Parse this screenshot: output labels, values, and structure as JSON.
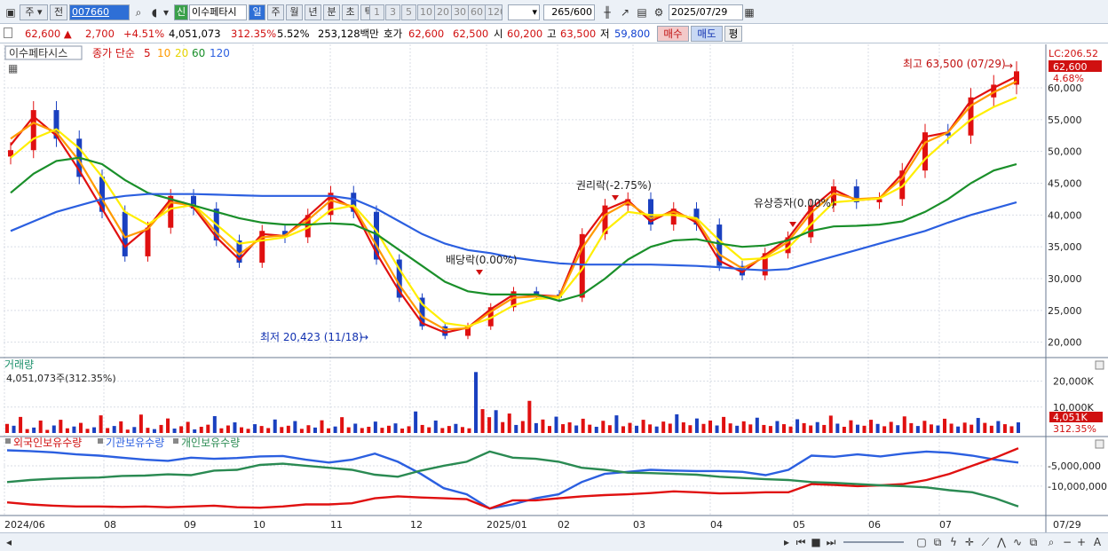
{
  "toolbar": {
    "market": "주",
    "type": "전",
    "code": "007660",
    "badge": "신",
    "name": "이수페타시",
    "periods": [
      "일",
      "주",
      "월",
      "년",
      "분",
      "초",
      "틱"
    ],
    "active_period": "일",
    "minute_steps": [
      "1",
      "3",
      "5",
      "10",
      "20",
      "30",
      "60",
      "120"
    ],
    "count": "265",
    "count_total": "/600",
    "date": "2025/07/29"
  },
  "quote": {
    "price": "62,600",
    "change": "2,700",
    "change_pct": "+4.51%",
    "volume": "4,051,073",
    "volume_ratio": "312.35%",
    "turnover": "5.52%",
    "amount": "253,128백만",
    "hoga_label": "호가",
    "ask": "62,600",
    "bid": "62,500",
    "open_label": "시",
    "open": "60,200",
    "high_label": "고",
    "high": "63,500",
    "low_label": "저",
    "low": "59,800",
    "buy": "매수",
    "sell": "매도",
    "eval": "평"
  },
  "price_panel": {
    "stock": "이수페타시스",
    "legend_prefix": "종가 단순",
    "ma_periods": [
      "5",
      "10",
      "20",
      "60",
      "120"
    ],
    "lc": "LC:206.52",
    "last": "62,600",
    "last_pct": "4.68%",
    "high_note": "최고 63,500 (07/29)",
    "low_note": "최저 20,423 (11/18)",
    "events": [
      "배당락(0.00%)",
      "권리락(-2.75%)",
      "유상증자(0.00%)"
    ]
  },
  "volume_panel": {
    "title": "거래량",
    "value": "4,051,073주(312.35%)",
    "last": "4,051K",
    "last_pct": "312.35%"
  },
  "holding_panel": {
    "series": [
      "외국인보유수량",
      "기관보유수량",
      "개인보유수량"
    ]
  },
  "chart_data": [
    {
      "type": "line",
      "title": "이수페타시스 일봉",
      "x": [
        "2024/06",
        "08",
        "09",
        "10",
        "11",
        "12",
        "2025/01",
        "02",
        "03",
        "04",
        "05",
        "06",
        "07",
        "07/29"
      ],
      "ylim": [
        18000,
        66000
      ],
      "yticks": [
        "20,000",
        "25,000",
        "30,000",
        "35,000",
        "40,000",
        "45,000",
        "50,000",
        "55,000",
        "60,000"
      ],
      "series": [
        {
          "name": "종가",
          "color": "#e01010",
          "values": [
            50200,
            56500,
            52000,
            46000,
            40500,
            33500,
            38000,
            43000,
            41000,
            36000,
            32500,
            37500,
            36500,
            40000,
            43500,
            40500,
            33000,
            27000,
            22500,
            21000,
            22500,
            25500,
            28000,
            27500,
            27000,
            37000,
            41500,
            42500,
            38500,
            41000,
            38500,
            32000,
            30500,
            34000,
            36500,
            41500,
            44500,
            42000,
            42500,
            47000,
            53000,
            52500,
            58500,
            60500,
            62600
          ]
        },
        {
          "name": "5",
          "color": "#e01010",
          "values": [
            51000,
            55500,
            52500,
            47000,
            41000,
            35000,
            38000,
            42500,
            41200,
            36500,
            33000,
            37000,
            36700,
            39800,
            43000,
            41000,
            34000,
            28000,
            23000,
            21500,
            22300,
            25200,
            27500,
            27400,
            27200,
            36000,
            40800,
            42300,
            39000,
            40800,
            38800,
            32800,
            31000,
            33700,
            36300,
            41000,
            44000,
            42300,
            42600,
            46500,
            52300,
            53000,
            58000,
            60000,
            61800
          ]
        },
        {
          "name": "10",
          "color": "#ff9a00",
          "values": [
            52000,
            54500,
            53000,
            48500,
            42500,
            36500,
            37800,
            42000,
            41500,
            37200,
            33800,
            36500,
            36800,
            39200,
            42300,
            41300,
            35200,
            29000,
            24000,
            22000,
            22200,
            24800,
            27000,
            27200,
            27200,
            34800,
            40000,
            42000,
            39500,
            40500,
            39200,
            33800,
            31600,
            33400,
            35800,
            40300,
            43400,
            42500,
            42700,
            45800,
            51400,
            53000,
            57200,
            59300,
            61000
          ]
        },
        {
          "name": "20",
          "color": "#ffee00",
          "values": [
            49000,
            52000,
            53500,
            50500,
            46000,
            40500,
            38500,
            41000,
            41600,
            38500,
            35500,
            36000,
            36500,
            38000,
            40800,
            41500,
            37500,
            31500,
            26000,
            23000,
            22500,
            23800,
            25800,
            26800,
            27000,
            31500,
            37500,
            40500,
            40000,
            40000,
            39500,
            36000,
            33000,
            33200,
            34800,
            38500,
            42000,
            42300,
            42600,
            44500,
            48800,
            52000,
            55000,
            57000,
            58500
          ]
        },
        {
          "name": "60",
          "color": "#1a8f2a",
          "values": [
            43500,
            46500,
            48500,
            49000,
            48000,
            45500,
            43500,
            42500,
            41500,
            40500,
            39500,
            38800,
            38500,
            38500,
            38700,
            38500,
            37000,
            34500,
            32000,
            29500,
            28000,
            27500,
            27500,
            27500,
            26500,
            27500,
            30000,
            33000,
            35000,
            36000,
            36200,
            35500,
            35000,
            35200,
            36000,
            37500,
            38200,
            38300,
            38500,
            39000,
            40500,
            42500,
            45000,
            47000,
            48000
          ]
        },
        {
          "name": "120",
          "color": "#2b5fe0",
          "values": [
            37500,
            39000,
            40500,
            41500,
            42500,
            43000,
            43300,
            43300,
            43300,
            43200,
            43100,
            43000,
            43000,
            43000,
            43000,
            42500,
            41000,
            39000,
            37000,
            35500,
            34500,
            34000,
            33300,
            32800,
            32400,
            32200,
            32200,
            32200,
            32200,
            32100,
            32000,
            31800,
            31500,
            31300,
            31500,
            32500,
            33500,
            34500,
            35500,
            36500,
            37500,
            38800,
            40000,
            41000,
            42000
          ]
        }
      ]
    },
    {
      "type": "bar",
      "title": "거래량",
      "ylim": [
        0,
        26000000
      ],
      "yticks": [
        "10,000K",
        "20,000K"
      ],
      "values": [
        3.5,
        2.8,
        6.2,
        1.5,
        2.1,
        4.8,
        1.2,
        2.9,
        5.1,
        1.8,
        2.5,
        3.9,
        1.6,
        2.2,
        6.8,
        1.9,
        2.7,
        4.5,
        1.3,
        2.3,
        7.1,
        2.0,
        1.5,
        3.1,
        5.6,
        1.7,
        2.6,
        4.3,
        1.4,
        2.4,
        3.2,
        6.5,
        1.8,
        2.9,
        4.1,
        2.2,
        1.6,
        3.4,
        2.7,
        1.9,
        5.2,
        2.3,
        2.8,
        4.6,
        1.6,
        3.0,
        2.1,
        4.9,
        1.8,
        2.5,
        6.1,
        2.2,
        3.6,
        1.9,
        2.4,
        4.4,
        2.0,
        2.8,
        3.7,
        1.7,
        2.6,
        8.3,
        3.1,
        2.2,
        4.8,
        1.9,
        2.7,
        3.5,
        2.3,
        1.8,
        23.5,
        9.2,
        6.1,
        8.8,
        4.2,
        7.5,
        3.1,
        4.6,
        12.4,
        3.8,
        5.2,
        2.7,
        6.3,
        3.4,
        4.1,
        2.9,
        5.5,
        3.2,
        2.4,
        4.7,
        3.0,
        6.8,
        2.6,
        3.9,
        2.8,
        5.1,
        3.3,
        2.5,
        4.4,
        3.6,
        7.2,
        4.1,
        3.0,
        5.6,
        3.5,
        4.8,
        2.9,
        6.2,
        3.7,
        2.8,
        4.5,
        3.3,
        5.9,
        3.1,
        2.7,
        4.6,
        3.4,
        2.5,
        5.3,
        3.8,
        2.9,
        4.2,
        3.1,
        6.7,
        3.6,
        2.4,
        4.9,
        3.2,
        2.8,
        5.1,
        3.5,
        2.6,
        4.3,
        3.0,
        6.4,
        3.8,
        2.7,
        4.7,
        3.3,
        2.9,
        5.5,
        3.6,
        2.5,
        4.0,
        3.2,
        5.8,
        3.9,
        2.8,
        4.6,
        3.4,
        2.6,
        4.1
      ]
    },
    {
      "type": "line",
      "title": "보유수량",
      "ylim": [
        -17000000,
        0
      ],
      "yticks": [
        "-5,000,000",
        "-10,000,000"
      ],
      "series": [
        {
          "name": "외국인보유수량",
          "color": "#2b5fe0",
          "values": [
            -1200000,
            -1400000,
            -1700000,
            -2200000,
            -2500000,
            -3000000,
            -3500000,
            -3800000,
            -3000000,
            -3300000,
            -3100000,
            -2700000,
            -2600000,
            -3500000,
            -4200000,
            -3500000,
            -2000000,
            -4000000,
            -7000000,
            -10500000,
            -12000000,
            -15500000,
            -14500000,
            -13000000,
            -12000000,
            -9000000,
            -7000000,
            -6500000,
            -6000000,
            -6200000,
            -6300000,
            -6300000,
            -6500000,
            -7300000,
            -6000000,
            -2500000,
            -2800000,
            -2200000,
            -2700000,
            -2000000,
            -1500000,
            -1800000,
            -2500000,
            -3500000,
            -4200000
          ]
        },
        {
          "name": "기관보유수량",
          "color": "#e01010",
          "values": [
            -14000000,
            -14500000,
            -14800000,
            -15000000,
            -15000000,
            -15100000,
            -15000000,
            -15200000,
            -15000000,
            -14800000,
            -15200000,
            -15300000,
            -15000000,
            -14500000,
            -14500000,
            -14200000,
            -13000000,
            -12500000,
            -12800000,
            -13000000,
            -13200000,
            -15500000,
            -13500000,
            -13500000,
            -13000000,
            -12500000,
            -12200000,
            -12000000,
            -11700000,
            -11300000,
            -11500000,
            -11800000,
            -11700000,
            -11500000,
            -11500000,
            -9500000,
            -9700000,
            -10000000,
            -9800000,
            -9500000,
            -8500000,
            -7000000,
            -5000000,
            -3000000,
            -700000
          ]
        },
        {
          "name": "개인보유수량",
          "color": "#2a8a52",
          "values": [
            -9000000,
            -8500000,
            -8200000,
            -8000000,
            -7900000,
            -7500000,
            -7400000,
            -7100000,
            -7300000,
            -6200000,
            -6000000,
            -4800000,
            -4500000,
            -5000000,
            -5500000,
            -6000000,
            -7200000,
            -7700000,
            -6200000,
            -5000000,
            -4000000,
            -1500000,
            -3000000,
            -3300000,
            -4000000,
            -5500000,
            -6000000,
            -6700000,
            -6800000,
            -7000000,
            -7200000,
            -7700000,
            -8000000,
            -8300000,
            -8500000,
            -9000000,
            -9200000,
            -9500000,
            -9800000,
            -10000000,
            -10300000,
            -11000000,
            -11500000,
            -13000000,
            -15000000
          ]
        }
      ]
    }
  ]
}
